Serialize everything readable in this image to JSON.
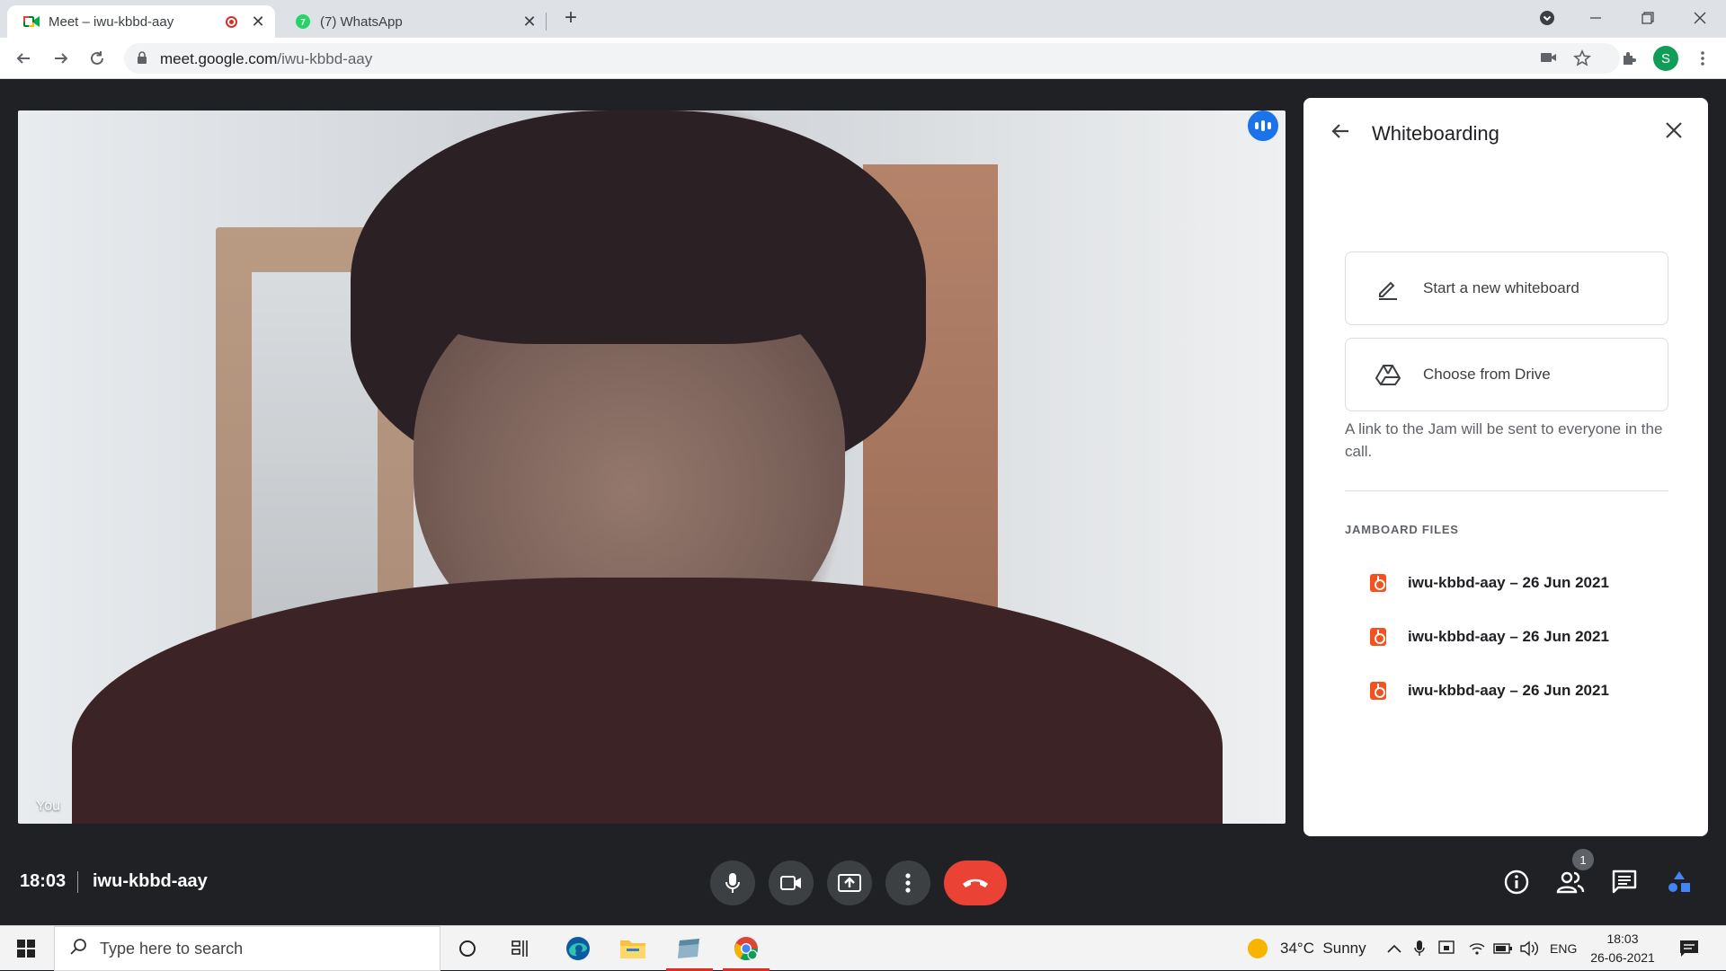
{
  "browser": {
    "tabs": [
      {
        "title": "Meet – iwu-kbbd-aay",
        "active": true,
        "recording": true
      },
      {
        "title": "(7) WhatsApp",
        "active": false,
        "badge": "7"
      }
    ],
    "address": {
      "host": "meet.google.com",
      "path": "/iwu-kbbd-aay"
    },
    "profile_initial": "S"
  },
  "video": {
    "self_label": "You"
  },
  "panel": {
    "title": "Whiteboarding",
    "options": [
      {
        "label": "Start a new whiteboard",
        "icon": "pencil-icon"
      },
      {
        "label": "Choose from Drive",
        "icon": "drive-icon"
      }
    ],
    "note": "A link to the Jam will be sent to everyone in the call.",
    "section_title": "JAMBOARD FILES",
    "files": [
      {
        "name": "iwu-kbbd-aay – 26 Jun 2021"
      },
      {
        "name": "iwu-kbbd-aay – 26 Jun 2021"
      },
      {
        "name": "iwu-kbbd-aay – 26 Jun 2021"
      }
    ]
  },
  "meetbar": {
    "time": "18:03",
    "meeting_code": "iwu-kbbd-aay",
    "participants_count": "1"
  },
  "taskbar": {
    "search_placeholder": "Type here to search",
    "weather": "34°C  Sunny",
    "language": "ENG",
    "clock_time": "18:03",
    "clock_date": "26-06-2021"
  },
  "colors": {
    "hangup": "#ea4335",
    "meet_bg": "#202124",
    "jamboard": "#f4511e",
    "accent": "#1a73e8"
  }
}
